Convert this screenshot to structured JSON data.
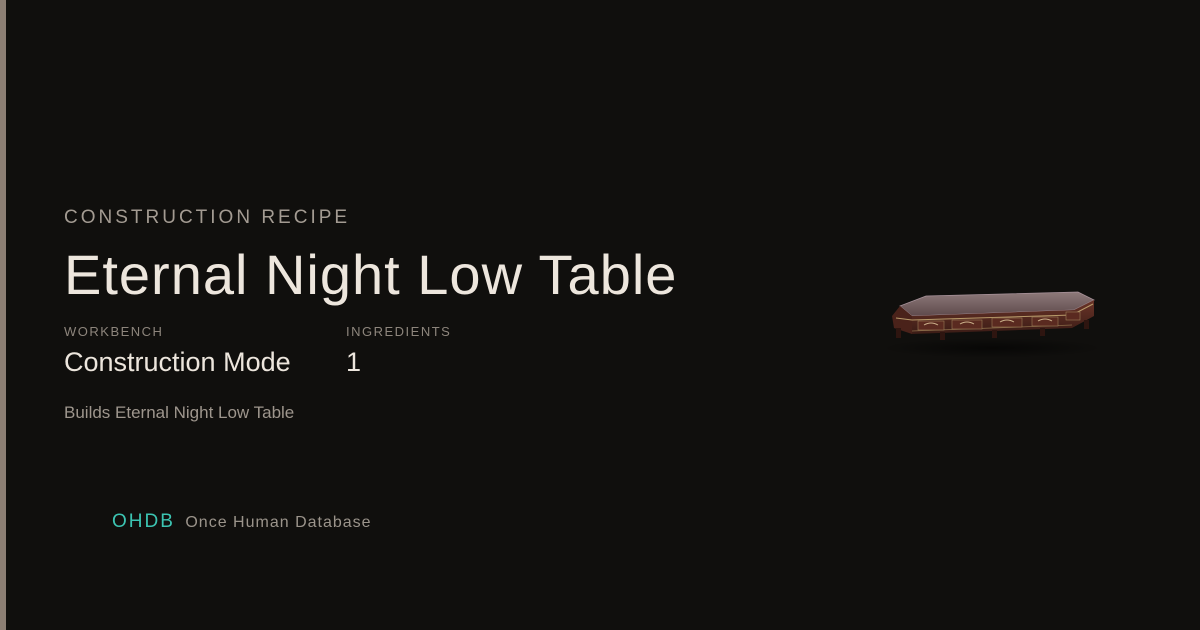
{
  "card": {
    "eyebrow": "CONSTRUCTION RECIPE",
    "title": "Eternal Night Low Table",
    "stats": {
      "workbench_label": "WORKBENCH",
      "workbench_value": "Construction Mode",
      "ingredients_label": "INGREDIENTS",
      "ingredients_value": "1"
    },
    "description": "Builds Eternal Night Low Table"
  },
  "brand": {
    "mark": "OHDB",
    "name": "Once Human Database"
  },
  "item_image": {
    "icon": "low-table-image"
  },
  "colors": {
    "background": "#100f0d",
    "accent_bar": "#8c7f73",
    "brand": "#3cc4b2",
    "title": "#ede6dd"
  }
}
